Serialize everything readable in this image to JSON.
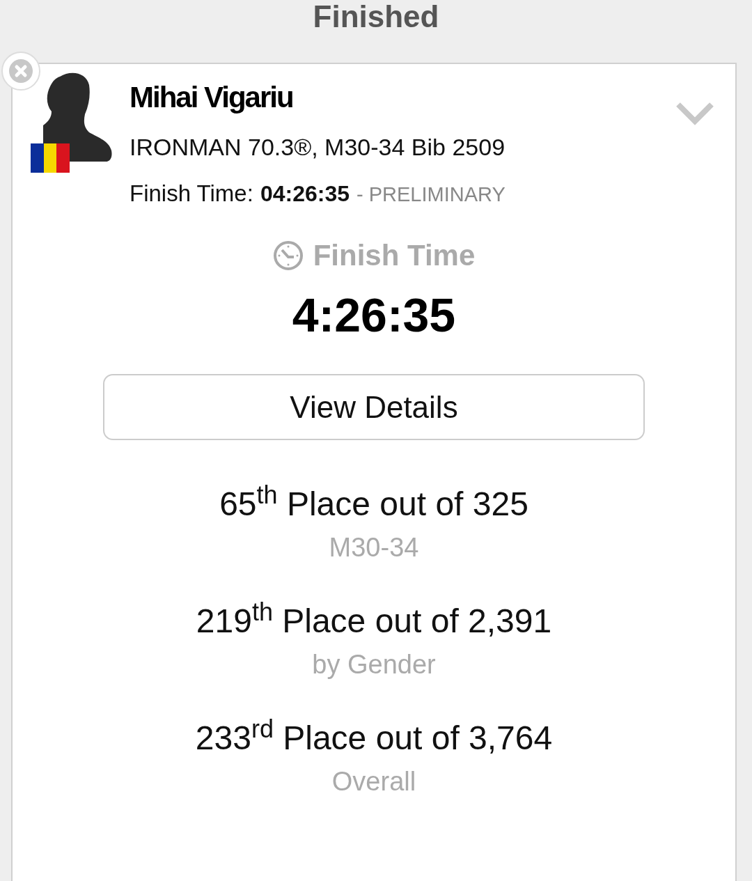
{
  "header": {
    "title": "Finished"
  },
  "athlete": {
    "name": "Mihai Vigariu",
    "race": "IRONMAN 70.3®, M30-34 Bib 2509",
    "finish_label": "Finish Time:",
    "finish_value": "04:26:35",
    "finish_status": "- PRELIMINARY",
    "expanded": false
  },
  "finish": {
    "heading": "Finish Time",
    "time": "4:26:35"
  },
  "details_button": "View Details",
  "rankings": [
    {
      "place": "65$^{th}$ Place out of 325",
      "category": "M30-34"
    },
    {
      "place": "219$^{th}$ Place out of 2,391",
      "category": "by Gender"
    },
    {
      "place": "233$^{rd}$ Place out of 3,764",
      "category": "Overall"
    }
  ]
}
